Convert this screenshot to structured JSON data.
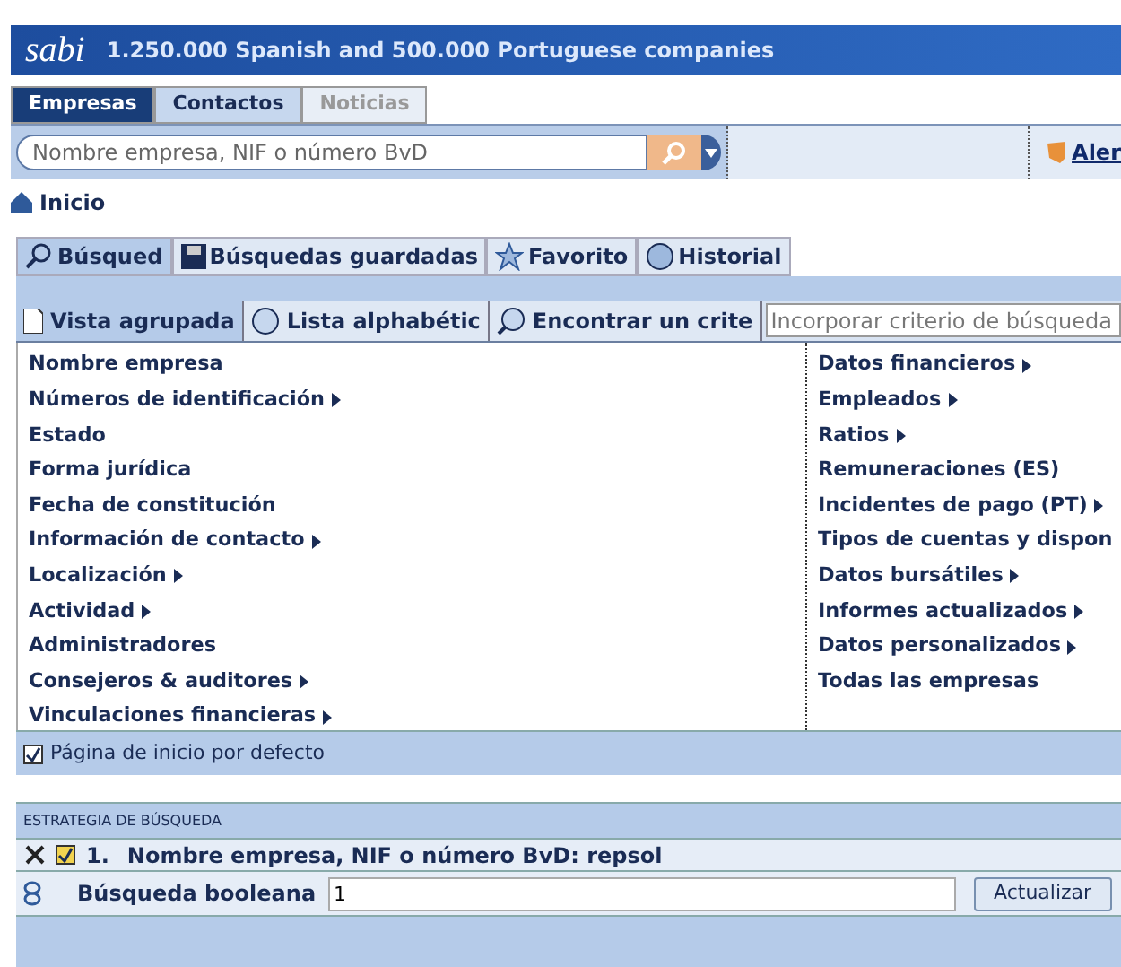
{
  "banner": {
    "logo": "sabi",
    "title": "1.250.000 Spanish and 500.000 Portuguese companies"
  },
  "main_tabs": [
    {
      "label": "Empresas",
      "selected": true,
      "disabled": false
    },
    {
      "label": "Contactos",
      "selected": false,
      "disabled": false
    },
    {
      "label": "Noticias",
      "selected": false,
      "disabled": true
    }
  ],
  "search": {
    "placeholder": "Nombre empresa, NIF o número BvD"
  },
  "alert_link": "Aler",
  "breadcrumb": "Inicio",
  "search_tabs": [
    {
      "label": "Búsqued",
      "selected": true
    },
    {
      "label": "Búsquedas guardadas",
      "selected": false
    },
    {
      "label": "Favorito",
      "selected": false
    },
    {
      "label": "Historial",
      "selected": false
    }
  ],
  "view_tabs": [
    {
      "label": "Vista agrupada",
      "selected": true
    },
    {
      "label": "Lista alphabétic",
      "selected": false
    },
    {
      "label": "Encontrar un crite",
      "selected": false
    }
  ],
  "criteria_search": {
    "placeholder": "Incorporar criterio de búsqueda"
  },
  "criteria_left": [
    {
      "label": "Nombre empresa",
      "expandable": false
    },
    {
      "label": "Números de identificación",
      "expandable": true
    },
    {
      "label": "Estado",
      "expandable": false
    },
    {
      "label": "Forma jurídica",
      "expandable": false
    },
    {
      "label": "Fecha de constitución",
      "expandable": false
    },
    {
      "label": "Información de contacto",
      "expandable": true
    },
    {
      "label": "Localización",
      "expandable": true
    },
    {
      "label": "Actividad",
      "expandable": true
    },
    {
      "label": "Administradores",
      "expandable": false
    },
    {
      "label": "Consejeros & auditores",
      "expandable": true
    },
    {
      "label": "Vinculaciones financieras",
      "expandable": true
    }
  ],
  "criteria_right": [
    {
      "label": "Datos financieros",
      "expandable": true
    },
    {
      "label": "Empleados",
      "expandable": true
    },
    {
      "label": "Ratios",
      "expandable": true
    },
    {
      "label": "Remuneraciones (ES)",
      "expandable": false
    },
    {
      "label": "Incidentes de pago (PT)",
      "expandable": true
    },
    {
      "label": "Tipos de cuentas y dispon",
      "expandable": false
    },
    {
      "label": "Datos bursátiles",
      "expandable": true
    },
    {
      "label": "Informes actualizados",
      "expandable": true
    },
    {
      "label": "Datos personalizados",
      "expandable": true
    },
    {
      "label": "Todas las empresas",
      "expandable": false
    }
  ],
  "default_home": {
    "label": "Página de inicio por defecto",
    "checked": true
  },
  "strategy": {
    "heading": "ESTRATEGIA DE BÚSQUEDA",
    "steps": [
      {
        "number": "1.",
        "text": "Nombre empresa, NIF o número BvD: repsol",
        "checked": true
      }
    ],
    "boolean_label": "Búsqueda booleana",
    "boolean_value": "1",
    "update_button": "Actualizar"
  }
}
